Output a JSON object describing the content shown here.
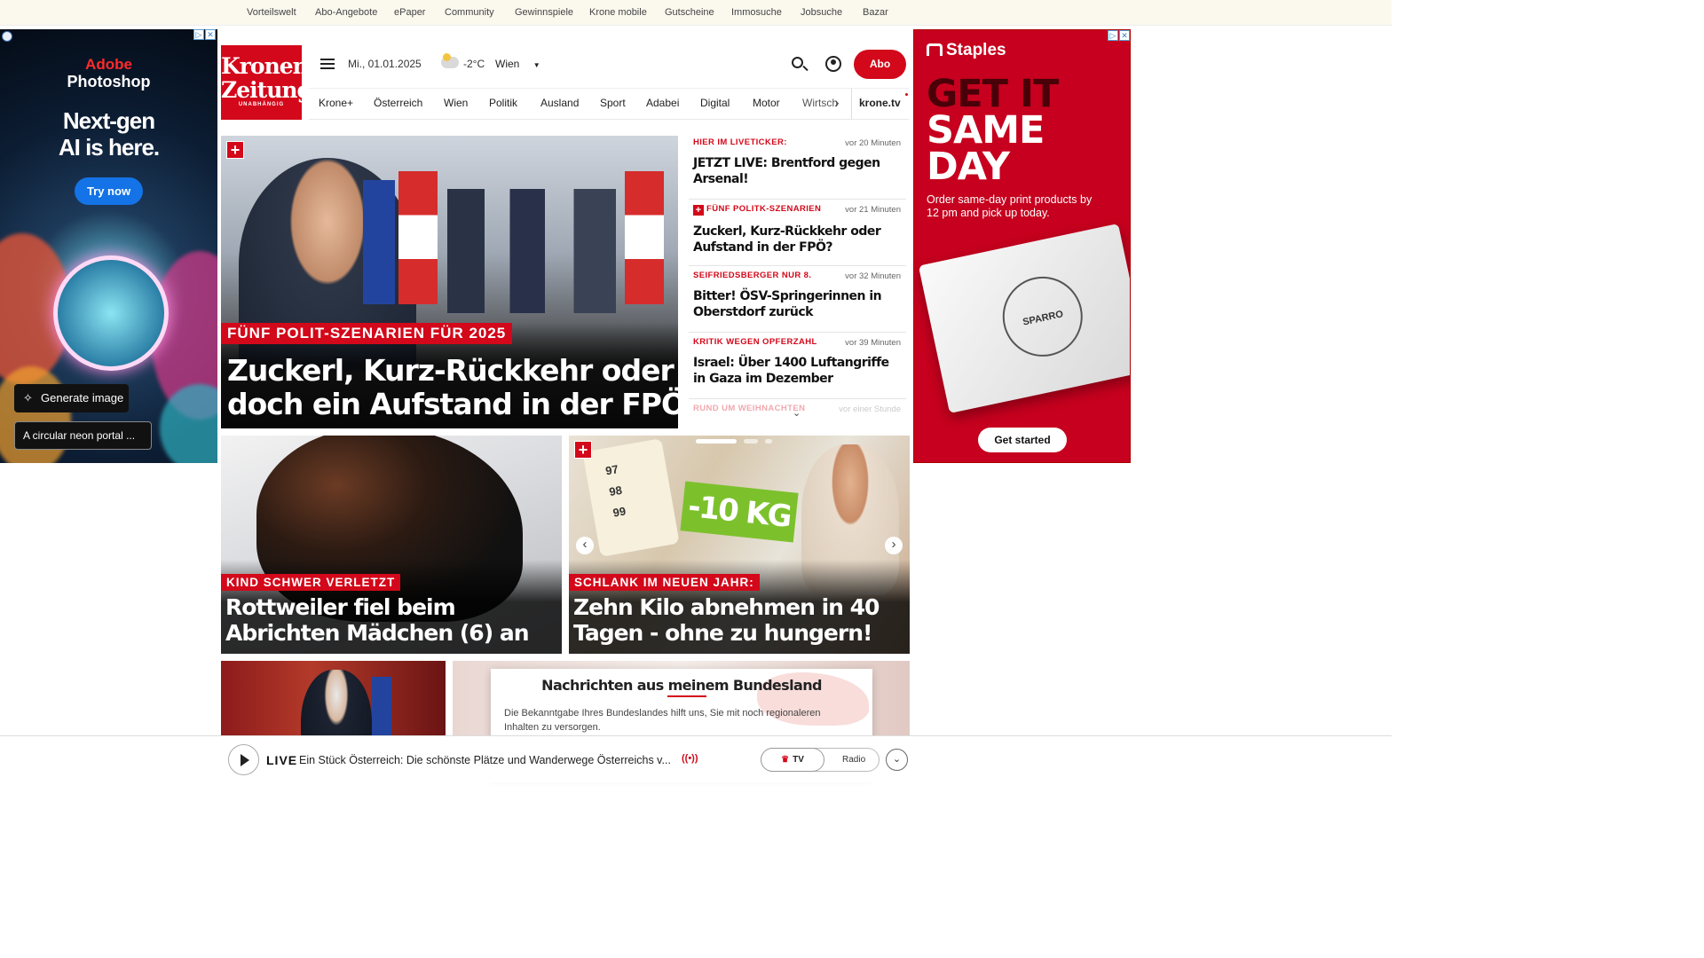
{
  "topnav": [
    "Vorteilswelt",
    "Abo-Angebote",
    "ePaper",
    "Community",
    "Gewinnspiele",
    "Krone mobile",
    "Gutscheine",
    "Immosuche",
    "Jobsuche",
    "Bazar"
  ],
  "left_ad": {
    "brand_line1": "Adobe",
    "brand_line2": "Photoshop",
    "headline_line1": "Next-gen",
    "headline_line2": "AI is here.",
    "cta": "Try now",
    "generate_button": "Generate image",
    "prompt_text": "A circular neon portal ..."
  },
  "right_ad": {
    "brand": "Staples",
    "headline_line1": "GET IT",
    "headline_line2": "SAME",
    "headline_line3": "DAY",
    "body": "Order same-day print products by 12 pm and pick up today.",
    "cta": "Get started",
    "bag_text": "SPARRO"
  },
  "logo": {
    "line1": "Kronen",
    "line2": "Zeitung",
    "sub": "UNABHÄNGIG"
  },
  "header": {
    "date": "Mi., 01.01.2025",
    "temperature": "-2°C",
    "city": "Wien",
    "abo_button": "Abo",
    "colors": {
      "accent": "#d3081a"
    }
  },
  "nav": [
    "Krone+",
    "Österreich",
    "Wien",
    "Politik",
    "Ausland",
    "Sport",
    "Adabei",
    "Digital",
    "Motor",
    "Wirtsch"
  ],
  "nav_tv": "krone.tv",
  "hero": {
    "kicker": "FÜNF POLIT-SZENARIEN FÜR 2025",
    "headline_line1": "Zuckerl, Kurz-Rückkehr oder",
    "headline_line2": "doch ein Aufstand in der FPÖ?"
  },
  "ticker": [
    {
      "kicker": "HIER IM LIVETICKER:",
      "time": "vor 20 Minuten",
      "title": "JETZT LIVE: Brentford gegen Arsenal!",
      "plus": false
    },
    {
      "kicker": "FÜNF POLITK-SZENARIEN",
      "time": "vor 21 Minuten",
      "title": "Zuckerl, Kurz-Rückkehr oder Aufstand in der FPÖ?",
      "plus": true
    },
    {
      "kicker": "SEIFRIEDSBERGER NUR 8.",
      "time": "vor 32 Minuten",
      "title": "Bitter! ÖSV-Springerinnen in Oberstdorf zurück",
      "plus": false
    },
    {
      "kicker": "KRITIK WEGEN OPFERZAHL",
      "time": "vor 39 Minuten",
      "title": "Israel: Über 1400 Luftangriffe in Gaza im Dezember",
      "plus": false
    },
    {
      "kicker": "RUND UM WEIHNACHTEN",
      "time": "vor einer Stunde",
      "title": "",
      "plus": false
    }
  ],
  "tile_left": {
    "kicker": "KIND SCHWER VERLETZT",
    "headline_line1": "Rottweiler fiel beim",
    "headline_line2": "Abrichten Mädchen (6) an"
  },
  "tile_right": {
    "kicker": "SCHLANK IM NEUEN JAHR:",
    "headline_line1": "Zehn Kilo abnehmen in 40",
    "headline_line2": "Tagen - ohne zu hungern!",
    "image_badge": "-10 KG",
    "tape_numbers": [
      "97",
      "98",
      "99"
    ]
  },
  "bundesland": {
    "title": "Nachrichten aus meinem Bundesland",
    "body_line1": "Die Bekanntgabe Ihres Bundeslandes hilft uns, Sie mit noch regionaleren",
    "body_line2": "Inhalten zu versorgen."
  },
  "player": {
    "live_label": "LIVE",
    "title": "Ein Stück Österreich: Die schönste Plätze und Wanderwege Österreichs v...",
    "tv": "TV",
    "radio": "Radio"
  }
}
